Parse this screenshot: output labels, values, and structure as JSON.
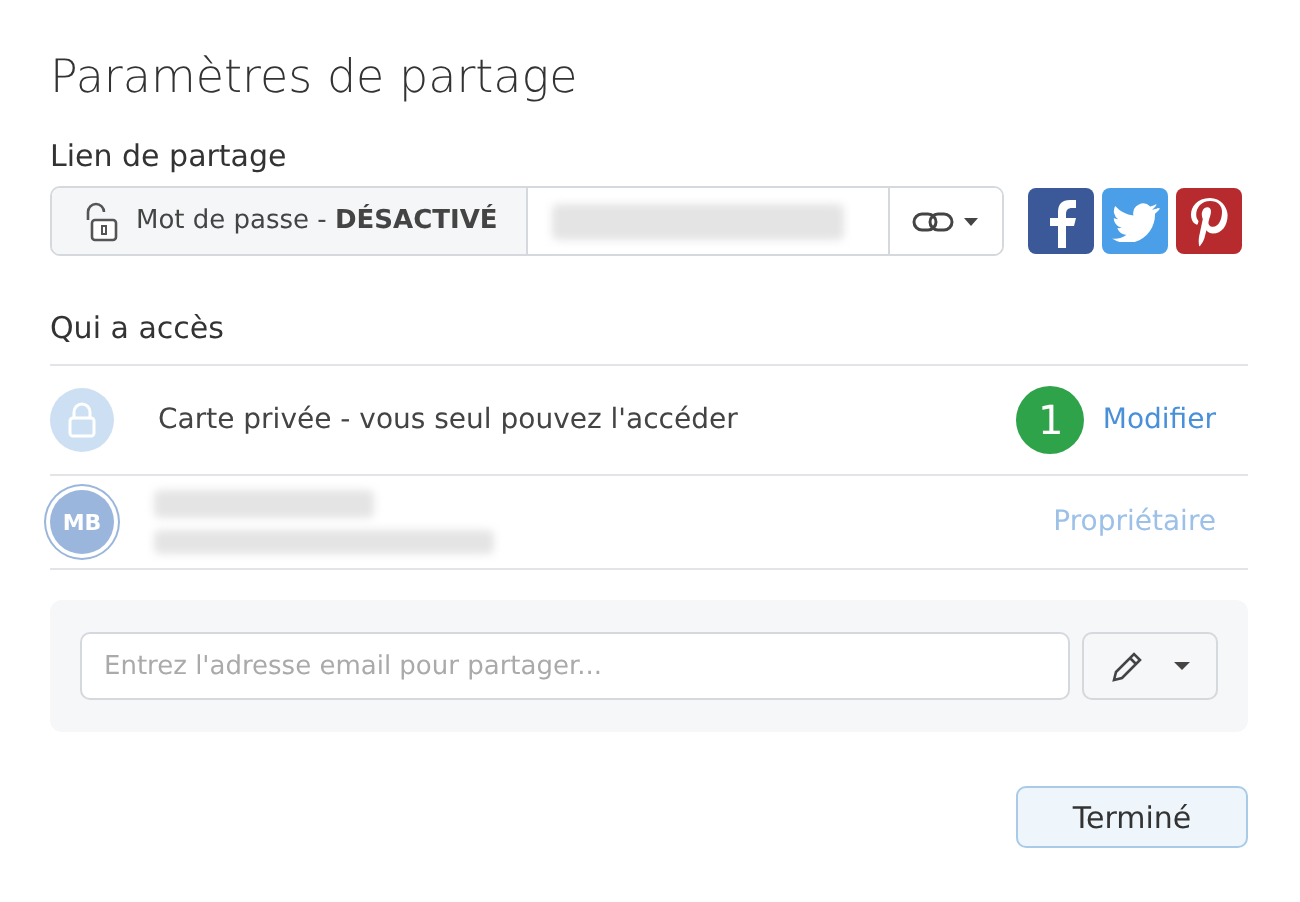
{
  "title": "Paramètres de partage",
  "share_link": {
    "label": "Lien de partage",
    "password": "Mot de passe - **DÉSACTIVÉ**"
  },
  "access": {
    "label": "Qui a accès",
    "rows": [
      {
        "kind": "privacy",
        "text": "Carte privée - vous seul pouvez l'accéder",
        "badge": "1",
        "action": "Modifier"
      },
      {
        "kind": "owner",
        "initials": "MB",
        "role": "Propriétaire"
      }
    ]
  },
  "invite": {
    "placeholder": "Entrez l'adresse email pour partager..."
  },
  "done_button": "Terminé"
}
